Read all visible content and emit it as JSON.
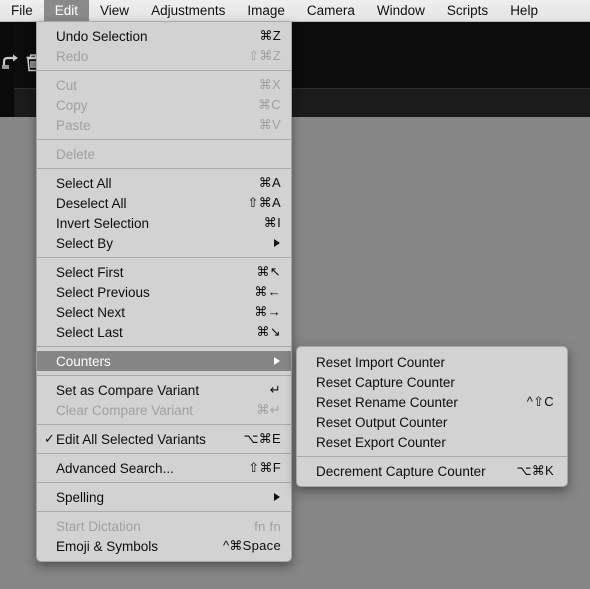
{
  "menubar": {
    "items": [
      {
        "label": "File",
        "active": false
      },
      {
        "label": "Edit",
        "active": true
      },
      {
        "label": "View",
        "active": false
      },
      {
        "label": "Adjustments",
        "active": false
      },
      {
        "label": "Image",
        "active": false
      },
      {
        "label": "Camera",
        "active": false
      },
      {
        "label": "Window",
        "active": false
      },
      {
        "label": "Scripts",
        "active": false
      },
      {
        "label": "Help",
        "active": false
      }
    ]
  },
  "toolbar": {
    "icons": [
      {
        "name": "rotate-icon"
      },
      {
        "name": "trash-icon"
      }
    ]
  },
  "edit_menu": {
    "title": "Edit",
    "groups": [
      {
        "items": [
          {
            "label": "Undo Selection",
            "shortcut": "⌘Z",
            "disabled": false
          },
          {
            "label": "Redo",
            "shortcut": "⇧⌘Z",
            "disabled": true
          }
        ]
      },
      {
        "items": [
          {
            "label": "Cut",
            "shortcut": "⌘X",
            "disabled": true
          },
          {
            "label": "Copy",
            "shortcut": "⌘C",
            "disabled": true
          },
          {
            "label": "Paste",
            "shortcut": "⌘V",
            "disabled": true
          }
        ]
      },
      {
        "items": [
          {
            "label": "Delete",
            "shortcut": "",
            "disabled": true
          }
        ]
      },
      {
        "items": [
          {
            "label": "Select All",
            "shortcut": "⌘A",
            "disabled": false
          },
          {
            "label": "Deselect All",
            "shortcut": "⇧⌘A",
            "disabled": false
          },
          {
            "label": "Invert Selection",
            "shortcut": "⌘I",
            "disabled": false
          },
          {
            "label": "Select By",
            "shortcut": "",
            "disabled": false,
            "submenu": true
          }
        ]
      },
      {
        "items": [
          {
            "label": "Select First",
            "shortcut": "⌘↖",
            "disabled": false
          },
          {
            "label": "Select Previous",
            "shortcut": "⌘←",
            "disabled": false
          },
          {
            "label": "Select Next",
            "shortcut": "⌘→",
            "disabled": false
          },
          {
            "label": "Select Last",
            "shortcut": "⌘↘",
            "disabled": false
          }
        ]
      },
      {
        "items": [
          {
            "label": "Counters",
            "shortcut": "",
            "disabled": false,
            "submenu": true,
            "highlighted": true
          }
        ]
      },
      {
        "items": [
          {
            "label": "Set as Compare Variant",
            "shortcut": "↵",
            "disabled": false
          },
          {
            "label": "Clear Compare Variant",
            "shortcut": "⌘↵",
            "disabled": true
          }
        ]
      },
      {
        "items": [
          {
            "label": "Edit All Selected Variants",
            "shortcut": "⌥⌘E",
            "disabled": false,
            "checked": true
          }
        ]
      },
      {
        "items": [
          {
            "label": "Advanced Search...",
            "shortcut": "⇧⌘F",
            "disabled": false
          }
        ]
      },
      {
        "items": [
          {
            "label": "Spelling",
            "shortcut": "",
            "disabled": false,
            "submenu": true
          }
        ]
      },
      {
        "items": [
          {
            "label": "Start Dictation",
            "shortcut": "fn fn",
            "disabled": true
          },
          {
            "label": "Emoji & Symbols",
            "shortcut": "^⌘Space",
            "disabled": false
          }
        ]
      }
    ]
  },
  "counters_submenu": {
    "title": "Counters",
    "groups": [
      {
        "items": [
          {
            "label": "Reset Import Counter",
            "shortcut": "",
            "disabled": false
          },
          {
            "label": "Reset Capture Counter",
            "shortcut": "",
            "disabled": false
          },
          {
            "label": "Reset Rename Counter",
            "shortcut": "^⇧C",
            "disabled": false
          },
          {
            "label": "Reset Output Counter",
            "shortcut": "",
            "disabled": false
          },
          {
            "label": "Reset Export Counter",
            "shortcut": "",
            "disabled": false
          }
        ]
      },
      {
        "items": [
          {
            "label": "Decrement Capture Counter",
            "shortcut": "⌥⌘K",
            "disabled": false
          }
        ]
      }
    ]
  },
  "colors": {
    "menu_background": "#d2d2d2",
    "menu_highlight": "#858585",
    "menubar_background": "#e9e9e9",
    "app_toolbar": "#0c0c0c",
    "app_canvas": "#868686",
    "text": "#0d0d0d",
    "text_disabled": "#a0a0a0"
  }
}
